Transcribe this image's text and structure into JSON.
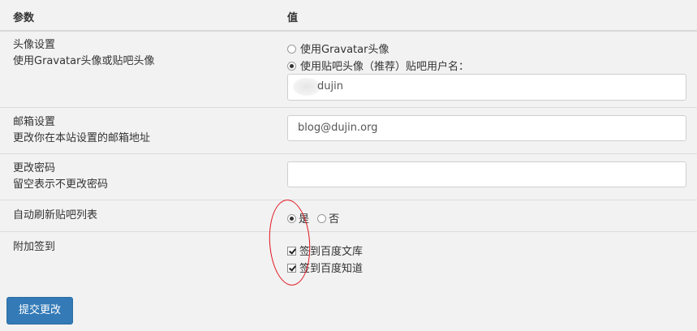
{
  "header": {
    "param": "参数",
    "value": "值"
  },
  "avatar": {
    "title": "头像设置",
    "desc": "使用Gravatar头像或贴吧头像",
    "option_gravatar": "使用Gravatar头像",
    "option_tieba": "使用贴吧头像（推荐）贴吧用户名：",
    "username_value": "dujin",
    "selected": "option_tieba"
  },
  "email": {
    "title": "邮箱设置",
    "desc": "更改你在本站设置的邮箱地址",
    "value": "blog@dujin.org"
  },
  "password": {
    "title": "更改密码",
    "desc": "留空表示不更改密码",
    "value": ""
  },
  "autorefresh": {
    "title": "自动刷新贴吧列表",
    "option_yes": "是",
    "option_no": "否",
    "selected": "option_yes"
  },
  "signin": {
    "title": "附加签到",
    "option_wenku": "签到百度文库",
    "option_zhidao": "签到百度知道",
    "wenku_checked": true,
    "zhidao_checked": true
  },
  "submit_label": "提交更改",
  "colors": {
    "primary_button": "#337ab7",
    "annotation": "#e0141e",
    "background": "#f2f2f2"
  }
}
